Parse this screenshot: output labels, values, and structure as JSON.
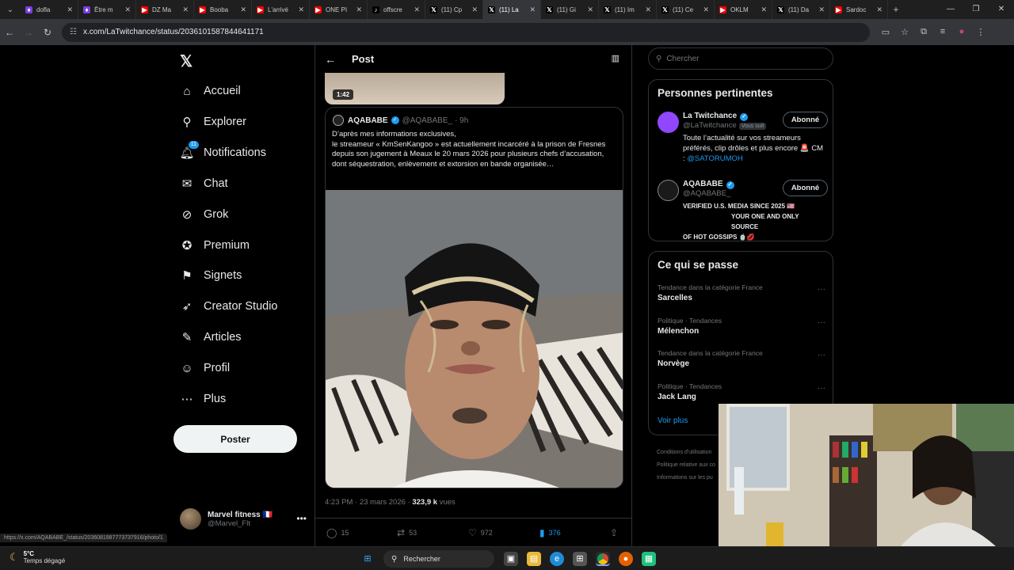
{
  "browser": {
    "tabs": [
      {
        "title": "dofla",
        "color": "#7b3fe4",
        "glyph": "♦"
      },
      {
        "title": "Être m",
        "color": "#7b3fe4",
        "glyph": "♦"
      },
      {
        "title": "DZ Ma",
        "color": "#ff0000",
        "glyph": "▶"
      },
      {
        "title": "Booba",
        "color": "#ff0000",
        "glyph": "▶"
      },
      {
        "title": "L'arrivé",
        "color": "#ff0000",
        "glyph": "▶"
      },
      {
        "title": "ONE PI",
        "color": "#ff0000",
        "glyph": "▶"
      },
      {
        "title": "offscre",
        "color": "#000000",
        "glyph": "♪"
      },
      {
        "title": "(11) Cp",
        "color": "#000000",
        "glyph": "𝕏"
      },
      {
        "title": "(11) La",
        "color": "#000000",
        "glyph": "𝕏"
      },
      {
        "title": "(11) Gi",
        "color": "#000000",
        "glyph": "𝕏"
      },
      {
        "title": "(11) Im",
        "color": "#000000",
        "glyph": "𝕏"
      },
      {
        "title": "(11) Ce",
        "color": "#000000",
        "glyph": "𝕏"
      },
      {
        "title": "OKLM",
        "color": "#ff0000",
        "glyph": "▶"
      },
      {
        "title": "(11) Da",
        "color": "#000000",
        "glyph": "𝕏"
      },
      {
        "title": "Sardoc",
        "color": "#ff0000",
        "glyph": "▶"
      }
    ],
    "active_tab_index": 8,
    "url": "x.com/LaTwitchance/status/2036101587844641171",
    "status_url": "https://x.com/AQABABE_/status/2036081987773737916/photo/1"
  },
  "nav": {
    "logo": "𝕏",
    "items": [
      {
        "label": "Accueil",
        "icon": "⌂",
        "name": "home-icon"
      },
      {
        "label": "Explorer",
        "icon": "⚲",
        "name": "search-icon"
      },
      {
        "label": "Notifications",
        "icon": "🔔︎",
        "name": "bell-icon",
        "badge": "11"
      },
      {
        "label": "Chat",
        "icon": "✉",
        "name": "mail-icon"
      },
      {
        "label": "Grok",
        "icon": "⊘",
        "name": "grok-icon"
      },
      {
        "label": "Premium",
        "icon": "✪",
        "name": "premium-icon"
      },
      {
        "label": "Signets",
        "icon": "⚑",
        "name": "bookmark-icon"
      },
      {
        "label": "Creator Studio",
        "icon": "➶",
        "name": "rocket-icon"
      },
      {
        "label": "Articles",
        "icon": "✎",
        "name": "articles-icon"
      },
      {
        "label": "Profil",
        "icon": "☺",
        "name": "profile-icon"
      },
      {
        "label": "Plus",
        "icon": "⋯",
        "name": "more-icon"
      }
    ],
    "post_button": "Poster",
    "account": {
      "name": "Marvel fitness 🇫🇷",
      "handle": "@Marvel_Flt"
    }
  },
  "main": {
    "header_title": "Post",
    "prev_duration": "1:42",
    "quote": {
      "name": "AQABABE",
      "handle": "@AQABABE_",
      "time": "· 9h",
      "text": "D’après mes informations exclusives,\nle streameur « KmSenKangoo » est actuellement incarcéré à la prison de Fresnes depuis son jugement à Meaux le 20 mars 2026 pour plusieurs chefs d’accusation, dont séquestration, enlèvement et extorsion en bande organisée…"
    },
    "timestamp": "4:23 PM · 23 mars 2026 ·",
    "views_count": "323,9 k",
    "views_label": "vues",
    "actions": {
      "replies": "15",
      "reposts": "53",
      "likes": "972",
      "bookmarks": "376"
    }
  },
  "right": {
    "search_placeholder": "Chercher",
    "people_title": "Personnes pertinentes",
    "people": [
      {
        "name": "La Twitchance",
        "handle": "@LaTwitchance",
        "follows_you": "Vous suit",
        "bio": "Toute l’actualité sur vos streameurs préférés, clip drôles et plus encore 🚨 CM : ",
        "bio_link": "@SATORUMOH",
        "button": "Abonné"
      },
      {
        "name": "AQABABE",
        "handle": "@AQABABE_",
        "bio_line1": "VERIFIED U.S. MEDIA SINCE 2025 🇺🇸",
        "bio_line2": "YOUR ONE AND ONLY SOURCE",
        "bio_line3": "OF HOT GOSSIPS 🍵💋",
        "button": "Abonné"
      }
    ],
    "trends_title": "Ce qui se passe",
    "trends": [
      {
        "category": "Tendance dans la catégorie France",
        "name": "Sarcelles"
      },
      {
        "category": "Politique · Tendances",
        "name": "Mélenchon"
      },
      {
        "category": "Tendance dans la catégorie France",
        "name": "Norvège"
      },
      {
        "category": "Politique · Tendances",
        "name": "Jack Lang"
      }
    ],
    "show_more": "Voir plus",
    "footer": [
      "Conditions d'utilisation",
      "Politique relative aux co",
      "Informations sur les pu"
    ]
  },
  "taskbar": {
    "weather_temp": "5°C",
    "weather_desc": "Temps dégagé",
    "search_label": "Rechercher"
  }
}
